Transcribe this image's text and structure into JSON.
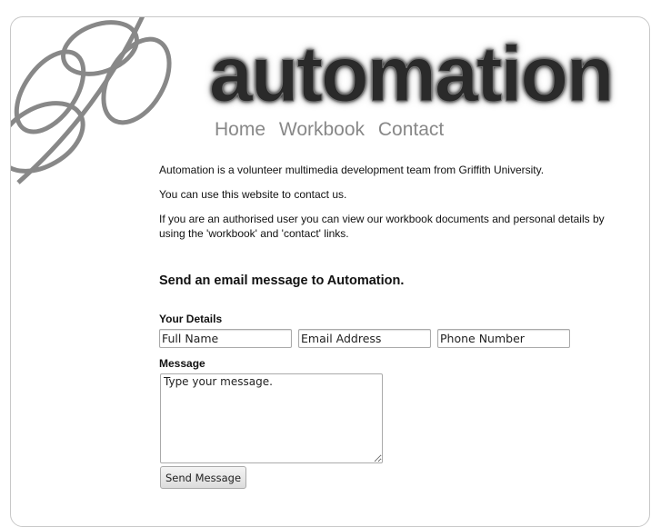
{
  "header": {
    "logo_text": "automation",
    "nav": [
      "Home",
      "Workbook",
      "Contact"
    ]
  },
  "intro": [
    "Automation is a volunteer multimedia development team from Griffith University.",
    "You can use this website to contact us.",
    "If you are an authorised user you can view our workbook documents and personal details by using the 'workbook' and 'contact' links."
  ],
  "form": {
    "title": "Send an email message to Automation.",
    "details_label": "Your Details",
    "full_name": "Full Name",
    "email": "Email Address",
    "phone": "Phone Number",
    "message_label": "Message",
    "message": "Type your message.",
    "submit": "Send Message"
  }
}
